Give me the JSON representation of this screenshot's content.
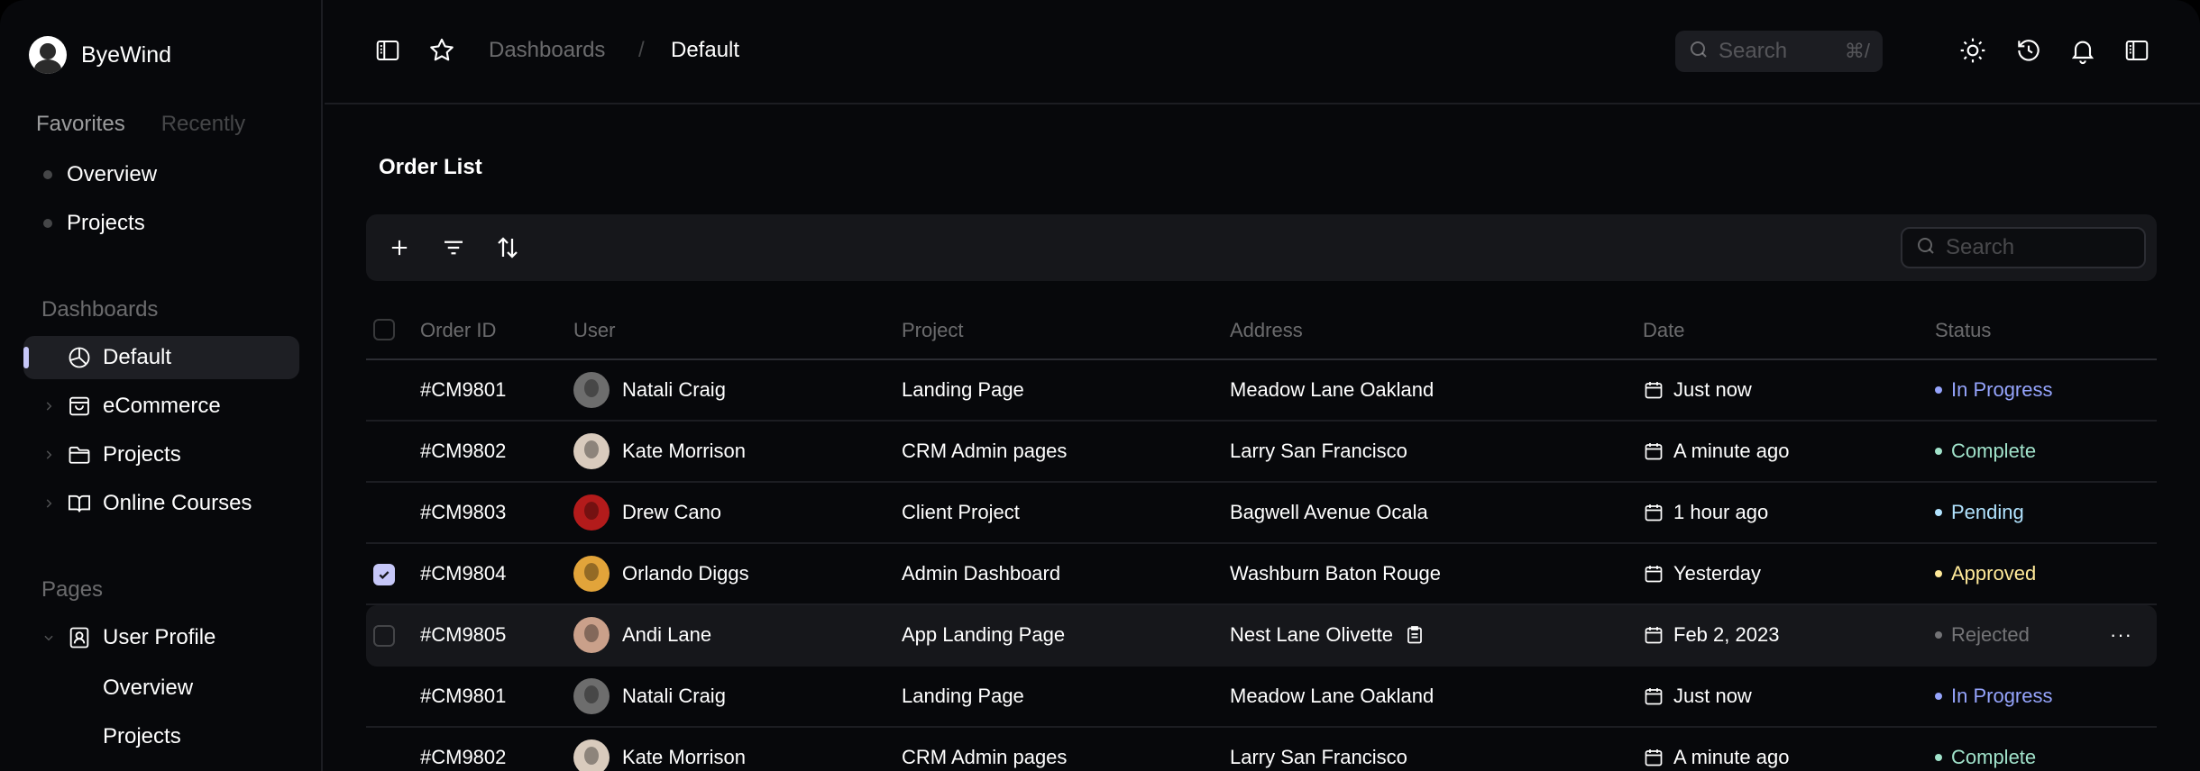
{
  "brand": {
    "name": "ByeWind"
  },
  "sidebar": {
    "tabs": [
      {
        "label": "Favorites"
      },
      {
        "label": "Recently"
      }
    ],
    "favorites": [
      {
        "label": "Overview"
      },
      {
        "label": "Projects"
      }
    ],
    "dashboards_label": "Dashboards",
    "dashboards": [
      {
        "label": "Default",
        "icon": "pie-chart-icon",
        "active": true
      },
      {
        "label": "eCommerce",
        "icon": "shopping-bag-icon"
      },
      {
        "label": "Projects",
        "icon": "folder-icon"
      },
      {
        "label": "Online Courses",
        "icon": "book-open-icon"
      }
    ],
    "pages_label": "Pages",
    "pages": [
      {
        "label": "User Profile",
        "icon": "user-square-icon",
        "expanded": true
      }
    ],
    "user_profile_children": [
      {
        "label": "Overview"
      },
      {
        "label": "Projects"
      }
    ]
  },
  "header": {
    "breadcrumb": [
      {
        "label": "Dashboards"
      },
      {
        "label": "/"
      },
      {
        "label": "Default"
      }
    ],
    "search": {
      "placeholder": "Search",
      "shortcut": "⌘/"
    },
    "icons": [
      "sidebar-toggle-icon",
      "star-icon",
      "sun-icon",
      "history-icon",
      "bell-icon",
      "right-panel-icon"
    ]
  },
  "main": {
    "title": "Order List",
    "toolbar": {
      "icons": [
        "plus-icon",
        "filter-icon",
        "sort-icon"
      ],
      "search_placeholder": "Search"
    },
    "columns": [
      "Order ID",
      "User",
      "Project",
      "Address",
      "Date",
      "Status"
    ],
    "rows": [
      {
        "id": "#CM9801",
        "user": "Natali Craig",
        "project": "Landing Page",
        "address": "Meadow Lane Oakland",
        "date": "Just now",
        "status": "In Progress"
      },
      {
        "id": "#CM9802",
        "user": "Kate Morrison",
        "project": "CRM Admin pages",
        "address": "Larry San Francisco",
        "date": "A minute ago",
        "status": "Complete"
      },
      {
        "id": "#CM9803",
        "user": "Drew Cano",
        "project": "Client Project",
        "address": "Bagwell Avenue Ocala",
        "date": "1 hour ago",
        "status": "Pending"
      },
      {
        "id": "#CM9804",
        "user": "Orlando Diggs",
        "project": "Admin Dashboard",
        "address": "Washburn Baton Rouge",
        "date": "Yesterday",
        "status": "Approved",
        "checked": true
      },
      {
        "id": "#CM9805",
        "user": "Andi Lane",
        "project": "App Landing Page",
        "address": "Nest Lane Olivette",
        "date": "Feb 2, 2023",
        "status": "Rejected",
        "hovered": true
      },
      {
        "id": "#CM9801",
        "user": "Natali Craig",
        "project": "Landing Page",
        "address": "Meadow Lane Oakland",
        "date": "Just now",
        "status": "In Progress"
      },
      {
        "id": "#CM9802",
        "user": "Kate Morrison",
        "project": "CRM Admin pages",
        "address": "Larry San Francisco",
        "date": "A minute ago",
        "status": "Complete"
      }
    ],
    "more_label": "···"
  },
  "colors": {
    "in_progress": "#95a4fc",
    "complete": "#a1e3cb",
    "pending": "#b1e3ff",
    "approved": "#ffe999",
    "rejected": "rgba(255,255,255,0.4)",
    "accent": "#c6c7f8"
  }
}
